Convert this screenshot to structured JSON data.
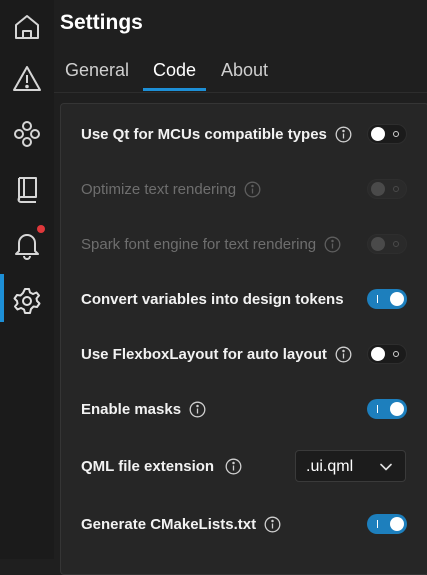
{
  "header": {
    "title": "Settings"
  },
  "tabs": [
    {
      "label": "General",
      "active": false
    },
    {
      "label": "Code",
      "active": true
    },
    {
      "label": "About",
      "active": false
    }
  ],
  "rail": {
    "items": [
      {
        "icon": "home-icon"
      },
      {
        "icon": "warning-icon"
      },
      {
        "icon": "components-icon"
      },
      {
        "icon": "book-icon"
      },
      {
        "icon": "bell-icon",
        "notification": true
      },
      {
        "icon": "gear-icon",
        "active": true
      }
    ]
  },
  "settings": [
    {
      "label": "Use Qt for MCUs compatible types",
      "state": "off",
      "enabled": true
    },
    {
      "label": "Optimize text rendering",
      "state": "off",
      "enabled": false
    },
    {
      "label": "Spark font engine for text rendering",
      "state": "off",
      "enabled": false
    },
    {
      "label": "Convert variables into design tokens",
      "state": "on",
      "enabled": true
    },
    {
      "label": "Use FlexboxLayout for auto layout",
      "state": "off",
      "enabled": true
    },
    {
      "label": "Enable masks",
      "state": "on",
      "enabled": true
    },
    {
      "label": "QML file extension",
      "control": "select",
      "value": ".ui.qml",
      "enabled": true
    },
    {
      "label": "Generate CMakeLists.txt",
      "state": "on",
      "enabled": true
    }
  ],
  "colors": {
    "accent": "#1d8fd6",
    "toggle_on": "#1d7fbd",
    "notification": "#e0383b",
    "background": "#1f1f1f",
    "panel": "#262626"
  }
}
